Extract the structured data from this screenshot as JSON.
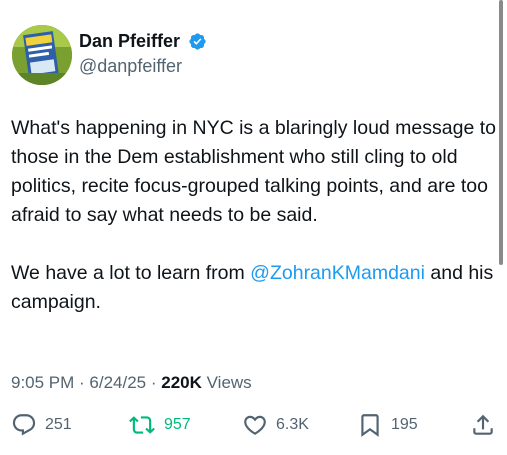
{
  "author": {
    "name": "Dan Pfeiffer",
    "handle": "@danpfeiffer",
    "verified": true,
    "verified_color": "#1d9bf0"
  },
  "tweet": {
    "text_part1": "What's happening in NYC is a blaringly loud message to those in the Dem establishment who still cling to old politics, recite focus-grouped talking points, and are too afraid to say what needs to be said.",
    "text_part2_before": "We have a lot to learn from ",
    "mention": "@ZohranKMamdani",
    "text_part2_after": " and his campaign.",
    "mention_color": "#1d9bf0"
  },
  "meta": {
    "time": "9:05 PM",
    "sep1": " · ",
    "date": "6/24/25",
    "sep2": " · ",
    "views_count": "220K",
    "views_label": " Views"
  },
  "actions": {
    "replies": "251",
    "retweets": "957",
    "retweet_color": "#00ba7c",
    "likes": "6.3K",
    "bookmarks": "195"
  },
  "icons": {
    "reply": "reply-icon",
    "retweet": "retweet-icon",
    "like": "heart-icon",
    "bookmark": "bookmark-icon",
    "share": "share-icon",
    "verified": "verified-badge-icon"
  }
}
